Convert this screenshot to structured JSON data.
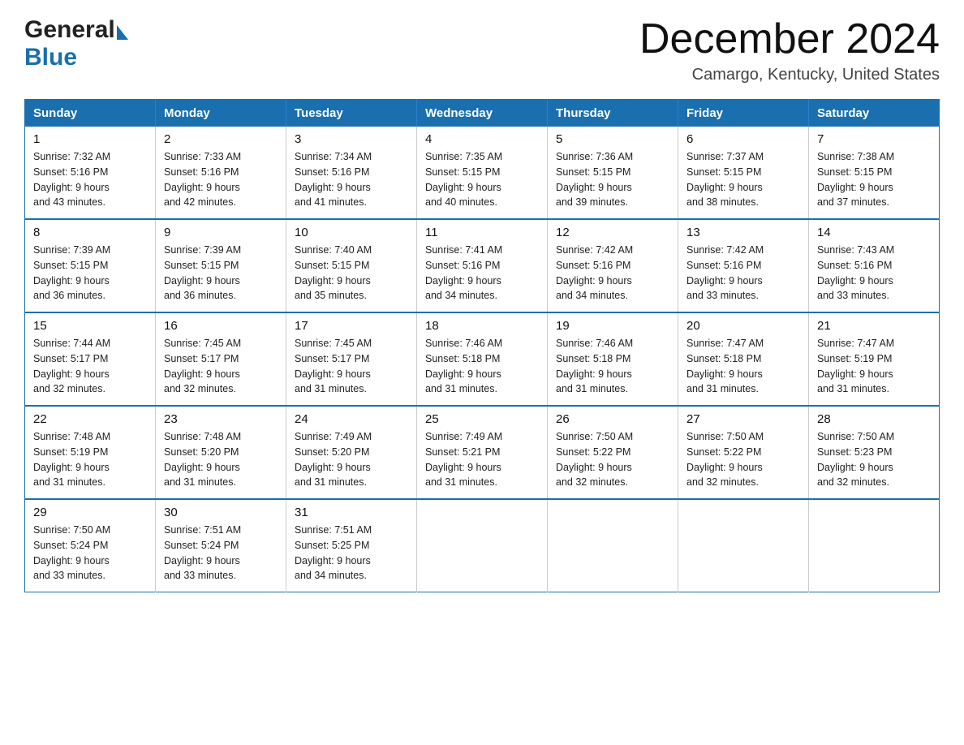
{
  "header": {
    "logo_general": "General",
    "logo_blue": "Blue",
    "title": "December 2024",
    "subtitle": "Camargo, Kentucky, United States"
  },
  "days_of_week": [
    "Sunday",
    "Monday",
    "Tuesday",
    "Wednesday",
    "Thursday",
    "Friday",
    "Saturday"
  ],
  "weeks": [
    [
      {
        "day": "1",
        "sunrise": "7:32 AM",
        "sunset": "5:16 PM",
        "daylight": "9 hours and 43 minutes."
      },
      {
        "day": "2",
        "sunrise": "7:33 AM",
        "sunset": "5:16 PM",
        "daylight": "9 hours and 42 minutes."
      },
      {
        "day": "3",
        "sunrise": "7:34 AM",
        "sunset": "5:16 PM",
        "daylight": "9 hours and 41 minutes."
      },
      {
        "day": "4",
        "sunrise": "7:35 AM",
        "sunset": "5:15 PM",
        "daylight": "9 hours and 40 minutes."
      },
      {
        "day": "5",
        "sunrise": "7:36 AM",
        "sunset": "5:15 PM",
        "daylight": "9 hours and 39 minutes."
      },
      {
        "day": "6",
        "sunrise": "7:37 AM",
        "sunset": "5:15 PM",
        "daylight": "9 hours and 38 minutes."
      },
      {
        "day": "7",
        "sunrise": "7:38 AM",
        "sunset": "5:15 PM",
        "daylight": "9 hours and 37 minutes."
      }
    ],
    [
      {
        "day": "8",
        "sunrise": "7:39 AM",
        "sunset": "5:15 PM",
        "daylight": "9 hours and 36 minutes."
      },
      {
        "day": "9",
        "sunrise": "7:39 AM",
        "sunset": "5:15 PM",
        "daylight": "9 hours and 36 minutes."
      },
      {
        "day": "10",
        "sunrise": "7:40 AM",
        "sunset": "5:15 PM",
        "daylight": "9 hours and 35 minutes."
      },
      {
        "day": "11",
        "sunrise": "7:41 AM",
        "sunset": "5:16 PM",
        "daylight": "9 hours and 34 minutes."
      },
      {
        "day": "12",
        "sunrise": "7:42 AM",
        "sunset": "5:16 PM",
        "daylight": "9 hours and 34 minutes."
      },
      {
        "day": "13",
        "sunrise": "7:42 AM",
        "sunset": "5:16 PM",
        "daylight": "9 hours and 33 minutes."
      },
      {
        "day": "14",
        "sunrise": "7:43 AM",
        "sunset": "5:16 PM",
        "daylight": "9 hours and 33 minutes."
      }
    ],
    [
      {
        "day": "15",
        "sunrise": "7:44 AM",
        "sunset": "5:17 PM",
        "daylight": "9 hours and 32 minutes."
      },
      {
        "day": "16",
        "sunrise": "7:45 AM",
        "sunset": "5:17 PM",
        "daylight": "9 hours and 32 minutes."
      },
      {
        "day": "17",
        "sunrise": "7:45 AM",
        "sunset": "5:17 PM",
        "daylight": "9 hours and 31 minutes."
      },
      {
        "day": "18",
        "sunrise": "7:46 AM",
        "sunset": "5:18 PM",
        "daylight": "9 hours and 31 minutes."
      },
      {
        "day": "19",
        "sunrise": "7:46 AM",
        "sunset": "5:18 PM",
        "daylight": "9 hours and 31 minutes."
      },
      {
        "day": "20",
        "sunrise": "7:47 AM",
        "sunset": "5:18 PM",
        "daylight": "9 hours and 31 minutes."
      },
      {
        "day": "21",
        "sunrise": "7:47 AM",
        "sunset": "5:19 PM",
        "daylight": "9 hours and 31 minutes."
      }
    ],
    [
      {
        "day": "22",
        "sunrise": "7:48 AM",
        "sunset": "5:19 PM",
        "daylight": "9 hours and 31 minutes."
      },
      {
        "day": "23",
        "sunrise": "7:48 AM",
        "sunset": "5:20 PM",
        "daylight": "9 hours and 31 minutes."
      },
      {
        "day": "24",
        "sunrise": "7:49 AM",
        "sunset": "5:20 PM",
        "daylight": "9 hours and 31 minutes."
      },
      {
        "day": "25",
        "sunrise": "7:49 AM",
        "sunset": "5:21 PM",
        "daylight": "9 hours and 31 minutes."
      },
      {
        "day": "26",
        "sunrise": "7:50 AM",
        "sunset": "5:22 PM",
        "daylight": "9 hours and 32 minutes."
      },
      {
        "day": "27",
        "sunrise": "7:50 AM",
        "sunset": "5:22 PM",
        "daylight": "9 hours and 32 minutes."
      },
      {
        "day": "28",
        "sunrise": "7:50 AM",
        "sunset": "5:23 PM",
        "daylight": "9 hours and 32 minutes."
      }
    ],
    [
      {
        "day": "29",
        "sunrise": "7:50 AM",
        "sunset": "5:24 PM",
        "daylight": "9 hours and 33 minutes."
      },
      {
        "day": "30",
        "sunrise": "7:51 AM",
        "sunset": "5:24 PM",
        "daylight": "9 hours and 33 minutes."
      },
      {
        "day": "31",
        "sunrise": "7:51 AM",
        "sunset": "5:25 PM",
        "daylight": "9 hours and 34 minutes."
      },
      null,
      null,
      null,
      null
    ]
  ],
  "labels": {
    "sunrise": "Sunrise:",
    "sunset": "Sunset:",
    "daylight": "Daylight:"
  }
}
